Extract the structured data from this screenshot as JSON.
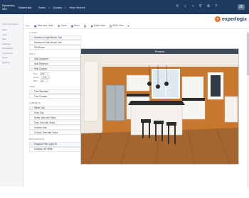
{
  "topbar": {
    "app": "Dynamics 365",
    "module": "Sales Hub",
    "breadcrumb": [
      "Sales",
      "Quotes",
      "New Kitchen"
    ],
    "separator": ">",
    "icons": [
      "search-icon",
      "lightbulb-icon",
      "plus-icon",
      "filter-icon",
      "gear-icon",
      "help-icon"
    ],
    "user": "JD"
  },
  "logo": {
    "text": "experlogix",
    "mark": "e"
  },
  "toolbar": {
    "items": [
      {
        "icon": "⟵",
        "label": ""
      },
      {
        "icon": "▣",
        "label": "Save and Close"
      },
      {
        "icon": "✖",
        "label": "Close"
      },
      {
        "icon": "▦",
        "label": "Book"
      },
      {
        "icon": "▤",
        "label": ""
      },
      {
        "icon": "◉",
        "label": "Quick View"
      },
      {
        "icon": "▥",
        "label": "BOM View"
      },
      {
        "icon": "▾",
        "label": ""
      }
    ]
  },
  "leftnav": {
    "header": "Sales Navigation",
    "items": [
      "Sites",
      "Area",
      "Plan",
      "Cabinets",
      "Backsplash",
      "Countertop",
      "Doors",
      "Lighting"
    ]
  },
  "groups": {
    "flooring": {
      "label": "FLOOR",
      "options": [
        "Hardwood Light Brown Oak",
        "Hardwood Dark Brown Oak",
        "Tile Brown"
      ],
      "selected": 0
    },
    "walls": {
      "label": "WALL",
      "options": [
        "Wall Standard",
        "Wall Rainbow",
        "Wall Custom"
      ],
      "selected": 2,
      "custom": [
        {
          "label": "Red",
          "value": "255"
        },
        {
          "label": "Green",
          "value": "128"
        },
        {
          "label": "Blue",
          "value": "64"
        }
      ]
    },
    "trim": {
      "label": "TRIM",
      "options": [
        "Trim Standard",
        "Trim Custom"
      ],
      "selected": 0
    },
    "cabinets": {
      "label": "CABINETS",
      "options": [
        "White Oak",
        "Gray Oak",
        "White Oak with Glass",
        "Gray Oak with Glass",
        "Custom Oak",
        "Custom Oak with Glass"
      ],
      "selected": 0
    },
    "backsplash": {
      "label": "BACKSPLASH",
      "options": [
        "Diagonal Tiles Light Gr.",
        "Subway Tile White"
      ],
      "selected": 0
    }
  },
  "preview": {
    "title": "Preview"
  },
  "colors": {
    "topbar": "#1f3a5f",
    "accent": "#e8742a",
    "wall": "#c8772f"
  }
}
